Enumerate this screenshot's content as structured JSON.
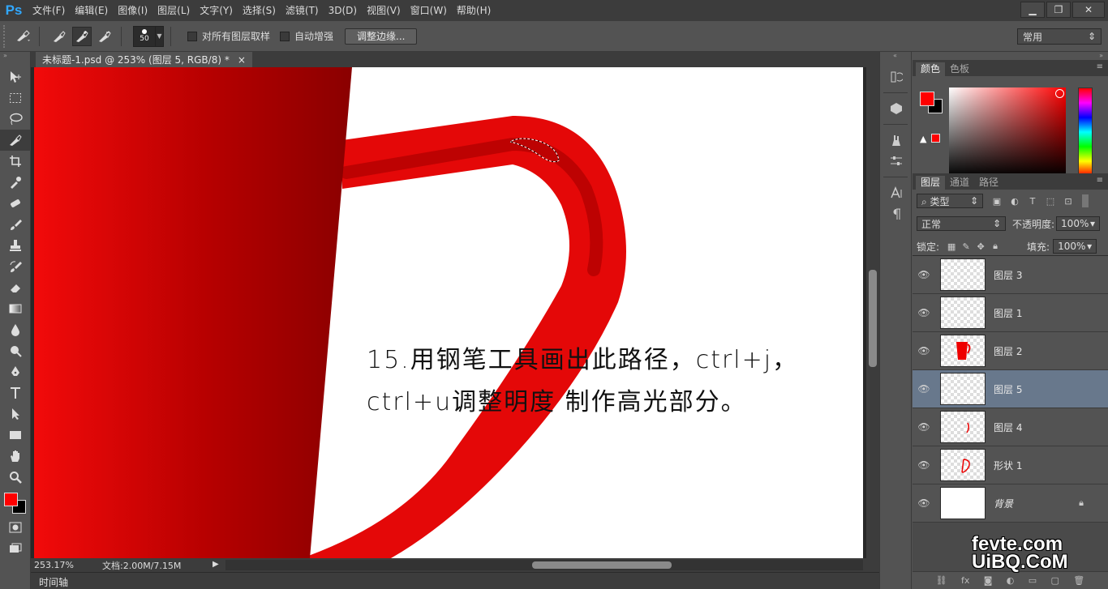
{
  "app": {
    "logo": "Ps",
    "menus": [
      "文件(F)",
      "编辑(E)",
      "图像(I)",
      "图层(L)",
      "文字(Y)",
      "选择(S)",
      "滤镜(T)",
      "3D(D)",
      "视图(V)",
      "窗口(W)",
      "帮助(H)"
    ],
    "window_controls": {
      "minimize": "▁",
      "restore": "❐",
      "close": "✕"
    }
  },
  "options": {
    "brush_size": "50",
    "sample_all_layers": "对所有图层取样",
    "auto_enhance": "自动增强",
    "refine_edge": "调整边缘...",
    "workspace": "常用"
  },
  "document": {
    "tab_title": "未标题-1.psd @ 253% (图层 5, RGB/8) *",
    "close_glyph": "×",
    "caption_line1": "15.用钢笔工具画出此路径，ctrl+j，",
    "caption_line2": "ctrl+u调整明度 制作高光部分。"
  },
  "status": {
    "zoom": "253.17%",
    "doc_info": "文档:2.00M/7.15M"
  },
  "timeline": {
    "label": "时间轴"
  },
  "color_panel": {
    "tabs": [
      "颜色",
      "色板"
    ],
    "foreground": "#ff0000",
    "background": "#000000"
  },
  "layers_panel": {
    "tabs": [
      "图层",
      "通道",
      "路径"
    ],
    "filter_kind": "类型",
    "blend_mode": "正常",
    "opacity_label": "不透明度:",
    "opacity": "100%",
    "lock_label": "锁定:",
    "fill_label": "填充:",
    "fill": "100%",
    "layers": [
      {
        "name": "图层 3",
        "selected": false
      },
      {
        "name": "图层 1",
        "selected": false
      },
      {
        "name": "图层 2",
        "selected": false
      },
      {
        "name": "图层 5",
        "selected": true
      },
      {
        "name": "图层 4",
        "selected": false
      },
      {
        "name": "形状 1",
        "selected": false
      },
      {
        "name": "背景",
        "selected": false
      }
    ]
  },
  "watermark": {
    "line1": "fevte.com",
    "line2": "UiBQ.CoM"
  },
  "colors": {
    "accent": "#31a8ff",
    "red": "#ff0000",
    "selected_layer": "#68788c"
  }
}
